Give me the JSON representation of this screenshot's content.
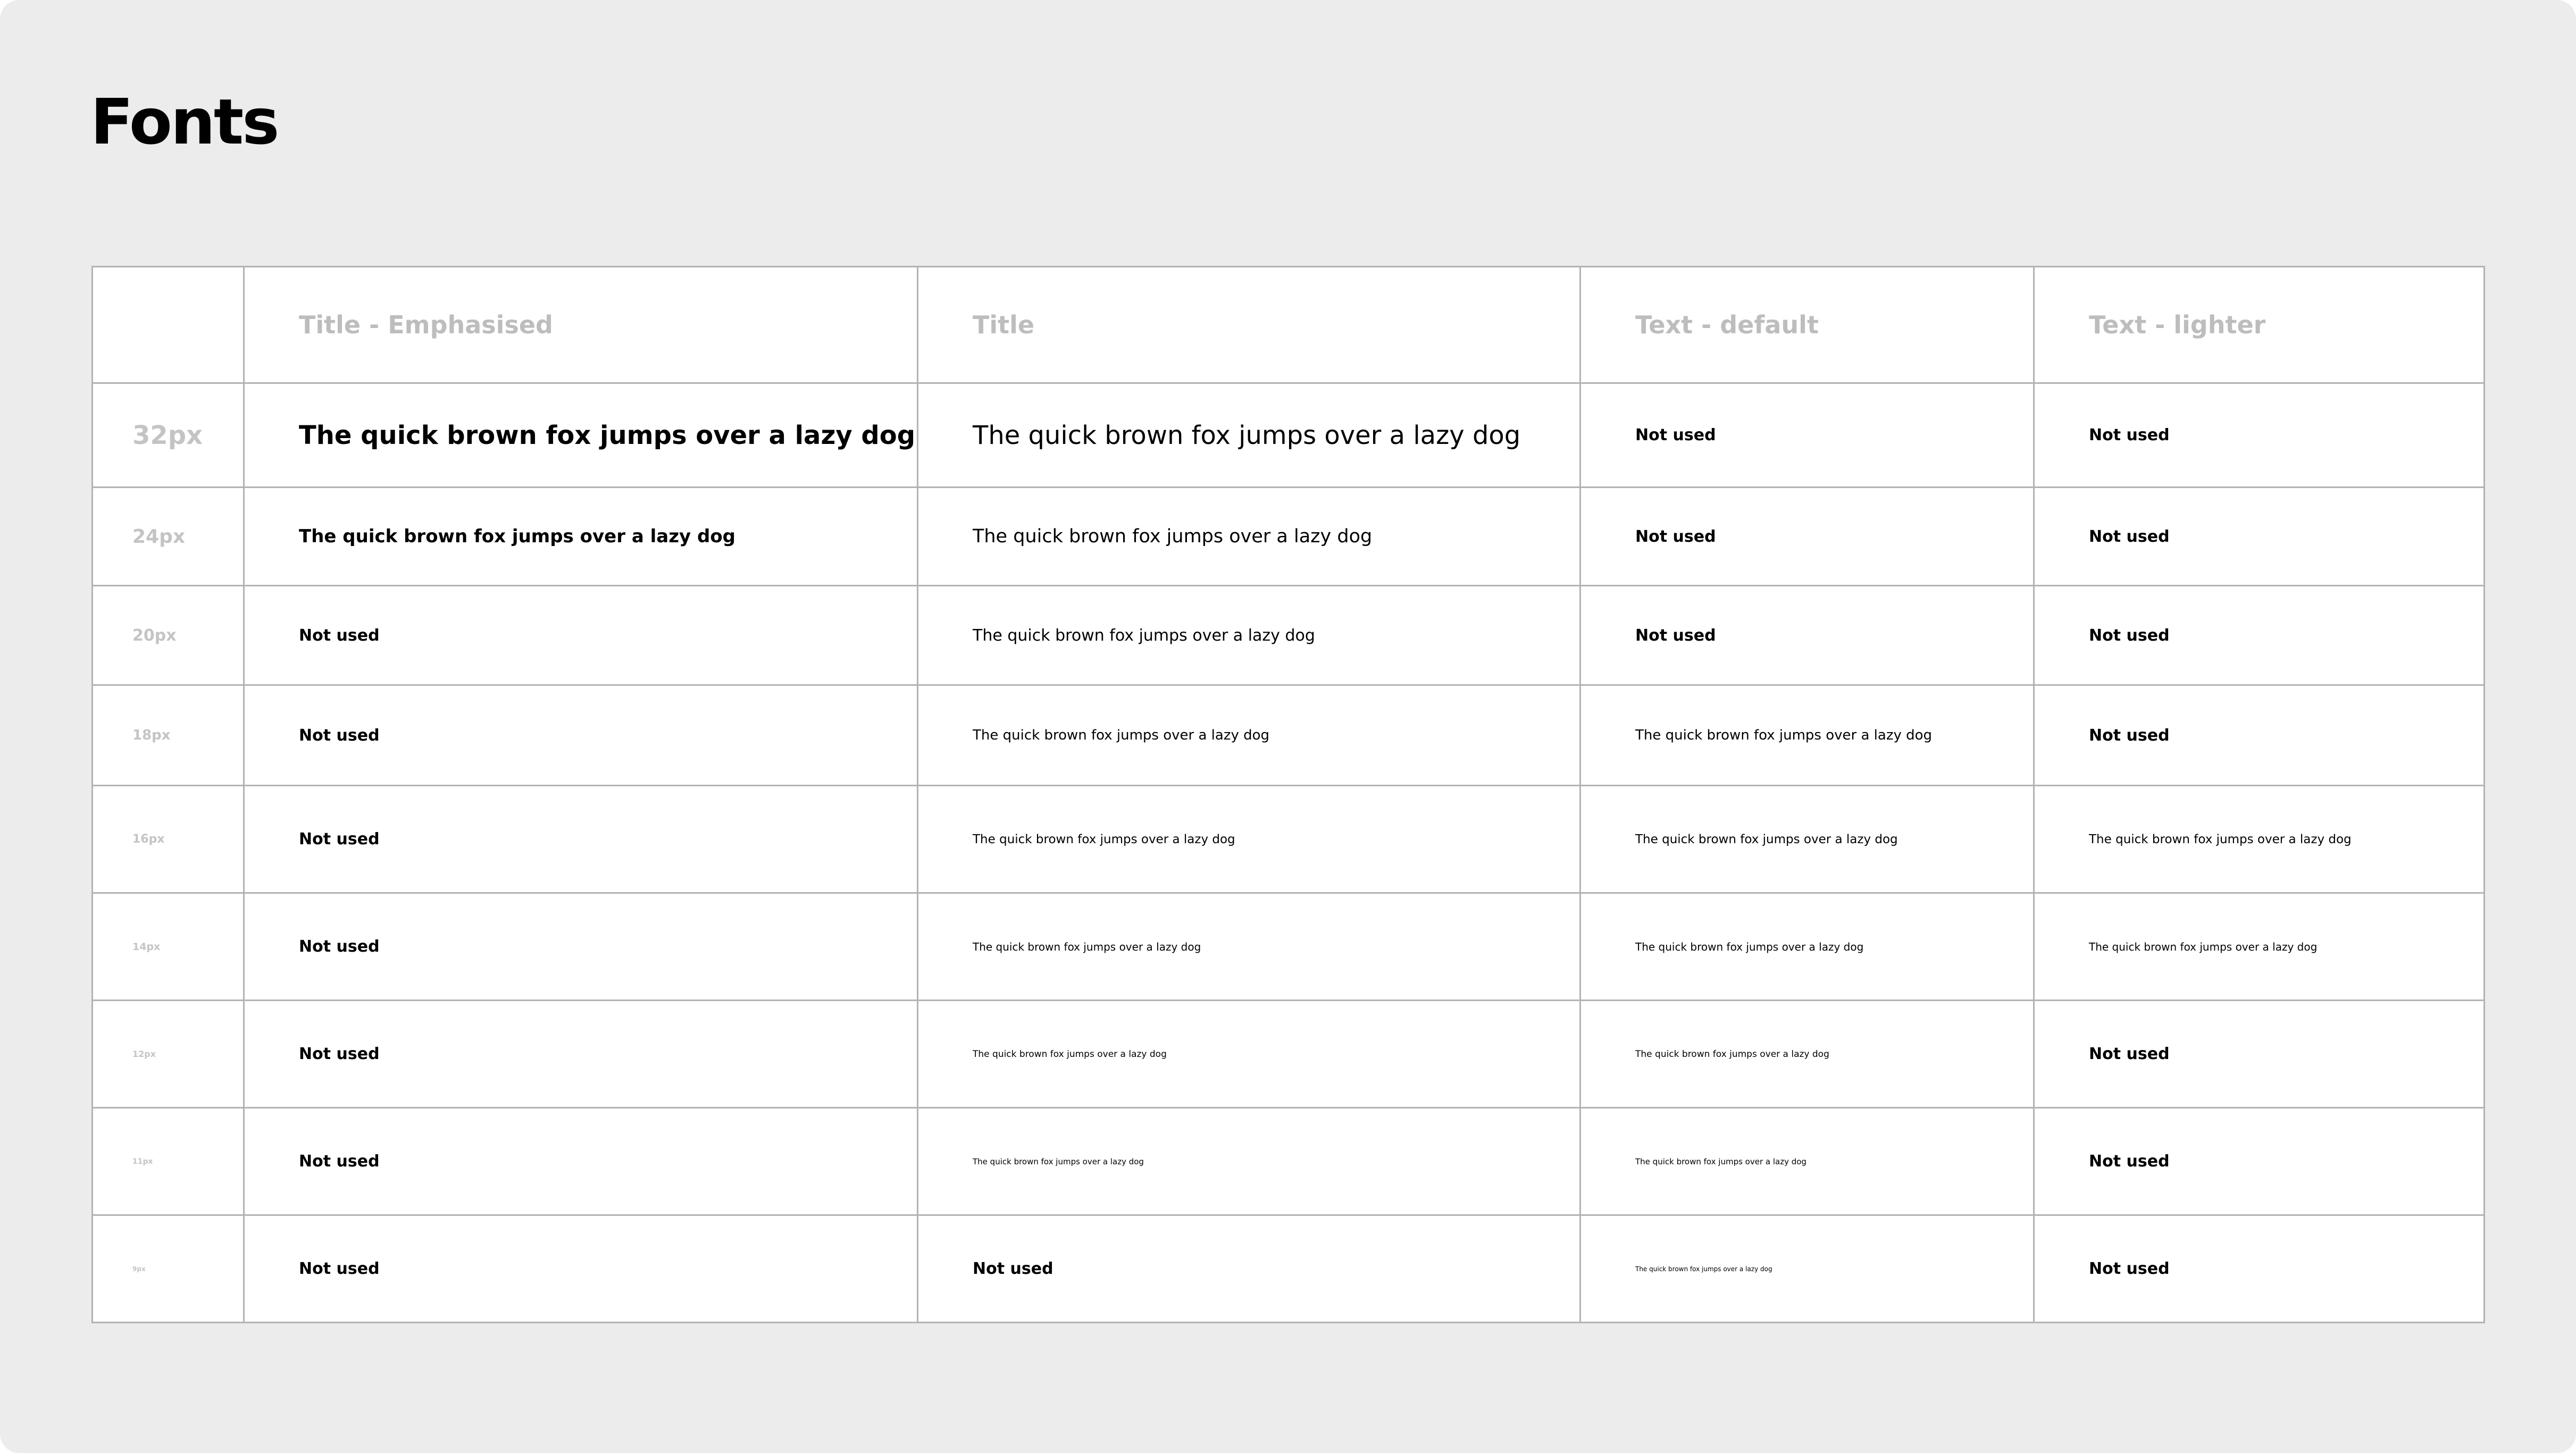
{
  "page": {
    "title": "Fonts"
  },
  "table": {
    "headers": [
      "",
      "Title - Emphasised",
      "Title",
      "Text - default",
      "Text - lighter"
    ],
    "rows": [
      {
        "size": "32px",
        "cells": [
          "The quick brown fox jumps over a lazy dog",
          "The quick brown fox jumps over a lazy dog",
          "Not used",
          "Not used"
        ]
      },
      {
        "size": "24px",
        "cells": [
          "The quick brown fox jumps over a lazy dog",
          "The quick brown fox jumps over a lazy dog",
          "Not used",
          "Not used"
        ]
      },
      {
        "size": "20px",
        "cells": [
          "Not used",
          "The quick brown fox jumps over a lazy dog",
          "Not used",
          "Not used"
        ]
      },
      {
        "size": "18px",
        "cells": [
          "Not used",
          "The quick brown fox jumps over a lazy dog",
          "The quick brown fox jumps over a lazy dog",
          "Not used"
        ]
      },
      {
        "size": "16px",
        "cells": [
          "Not used",
          "The quick brown fox jumps over a lazy dog",
          "The quick brown fox jumps over a lazy dog",
          "The quick brown fox jumps over a lazy dog"
        ]
      },
      {
        "size": "14px",
        "cells": [
          "Not used",
          "The quick brown fox jumps over a lazy dog",
          "The quick brown fox jumps over a lazy dog",
          "The quick brown fox jumps over a lazy dog"
        ]
      },
      {
        "size": "12px",
        "cells": [
          "Not used",
          "The quick brown fox jumps over a lazy dog",
          "The quick brown fox jumps over a lazy dog",
          "Not used"
        ]
      },
      {
        "size": "11px",
        "cells": [
          "Not used",
          "The quick brown fox jumps over a lazy dog",
          "The quick brown fox jumps over a lazy dog",
          "Not used"
        ]
      },
      {
        "size": "9px",
        "cells": [
          "Not used",
          "Not used",
          "The quick brown fox jumps over a lazy dog",
          "Not used"
        ]
      }
    ]
  }
}
